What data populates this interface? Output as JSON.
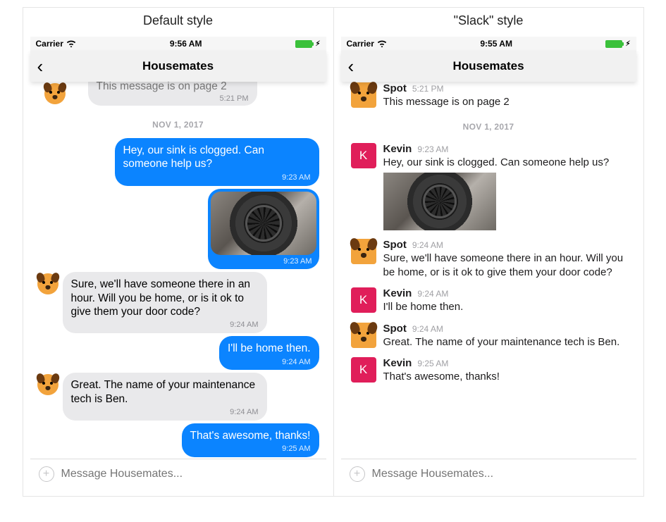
{
  "panel_titles": {
    "default": "Default style",
    "slack": "\"Slack\" style"
  },
  "status": {
    "carrier": "Carrier",
    "time_default": "9:56 AM",
    "time_slack": "9:55 AM"
  },
  "nav": {
    "title": "Housemates"
  },
  "composer": {
    "placeholder": "Message Housemates..."
  },
  "date_separator": "NOV 1, 2017",
  "users": {
    "spot": {
      "name": "Spot"
    },
    "kevin": {
      "name": "Kevin",
      "initial": "K"
    }
  },
  "cut_message": {
    "text": "This message is on page 2",
    "time": "5:21 PM"
  },
  "messages": [
    {
      "id": "m1",
      "user": "kevin",
      "side": "sent",
      "time": "9:23 AM",
      "text": "Hey, our sink is clogged. Can someone help us?"
    },
    {
      "id": "m2",
      "user": "kevin",
      "side": "sent",
      "time": "9:23 AM",
      "image": true
    },
    {
      "id": "m3",
      "user": "spot",
      "side": "recv",
      "time": "9:24 AM",
      "text": "Sure, we'll have someone there in an hour. Will you be home, or is it ok to give them your door code?"
    },
    {
      "id": "m4",
      "user": "kevin",
      "side": "sent",
      "time": "9:24 AM",
      "text": "I'll be home then."
    },
    {
      "id": "m5",
      "user": "spot",
      "side": "recv",
      "time": "9:24 AM",
      "text": "Great. The name of your maintenance tech is Ben."
    },
    {
      "id": "m6",
      "user": "kevin",
      "side": "sent",
      "time": "9:25 AM",
      "text": "That's awesome, thanks!"
    }
  ]
}
